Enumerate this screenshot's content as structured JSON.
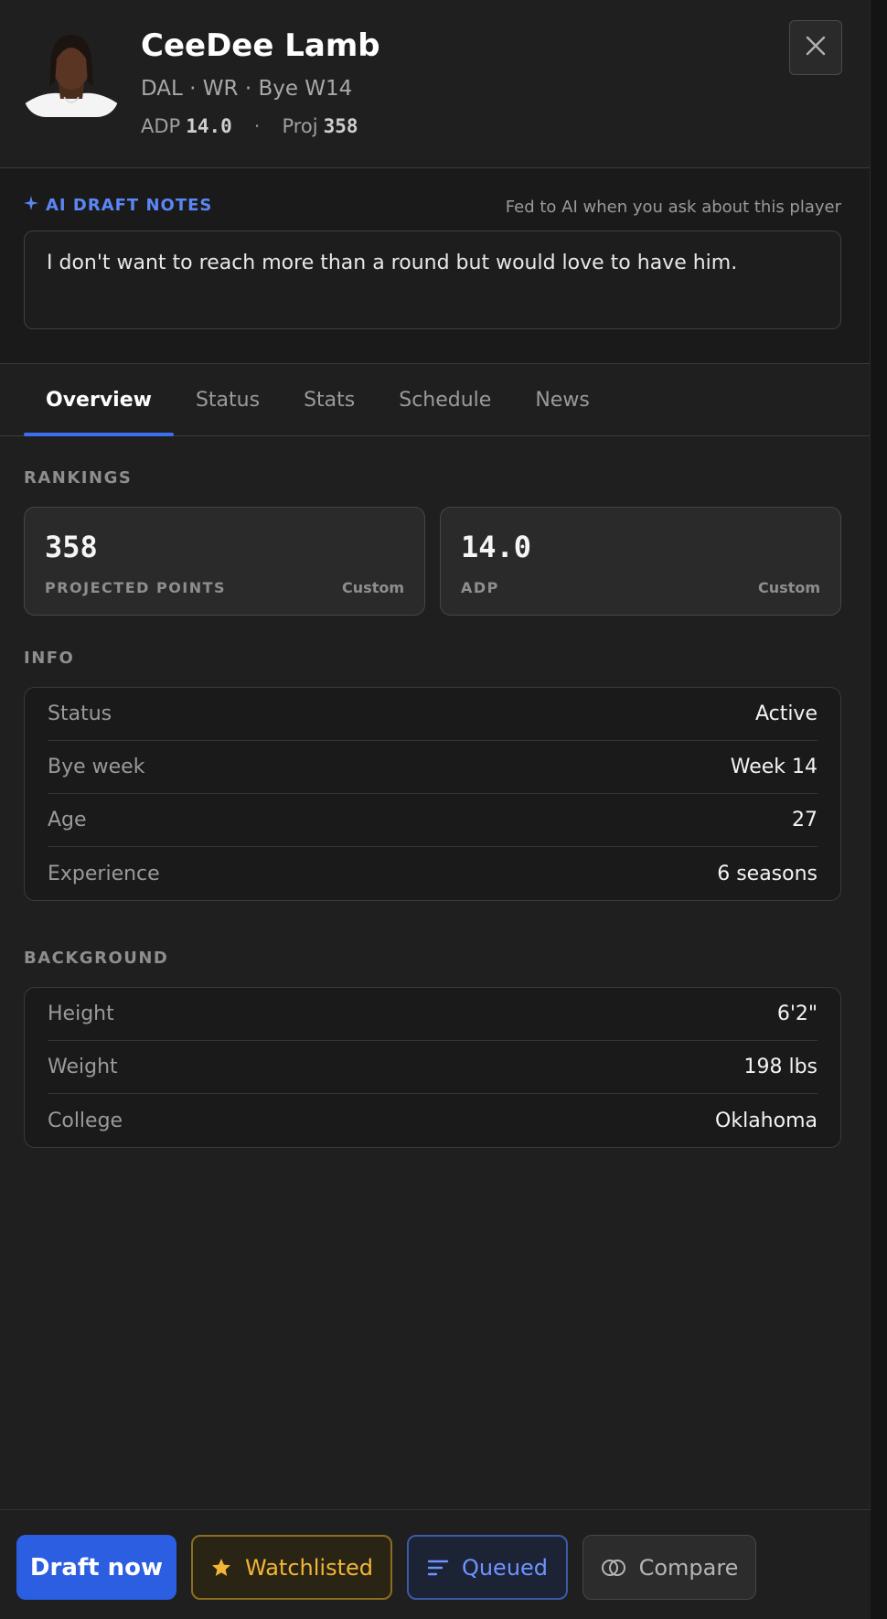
{
  "player": {
    "name": "CeeDee Lamb",
    "meta": "DAL · WR · Bye W14",
    "adp_label": "ADP",
    "adp_value": "14.0",
    "separator": "·",
    "proj_label": "Proj",
    "proj_value": "358"
  },
  "notes": {
    "label": "AI DRAFT NOTES",
    "hint": "Fed to AI when you ask about this player",
    "text": "I don't want to reach more than a round but would love to have him."
  },
  "tabs": [
    {
      "label": "Overview",
      "active": true
    },
    {
      "label": "Status"
    },
    {
      "label": "Stats"
    },
    {
      "label": "Schedule"
    },
    {
      "label": "News"
    }
  ],
  "rankings": {
    "title": "RANKINGS",
    "cards": [
      {
        "value": "358",
        "label": "PROJECTED POINTS",
        "source": "Custom"
      },
      {
        "value": "14.0",
        "label": "ADP",
        "source": "Custom"
      }
    ]
  },
  "info": {
    "title": "INFO",
    "rows": [
      {
        "key": "Status",
        "value": "Active"
      },
      {
        "key": "Bye week",
        "value": "Week 14"
      },
      {
        "key": "Age",
        "value": "27"
      },
      {
        "key": "Experience",
        "value": "6 seasons"
      }
    ]
  },
  "background": {
    "title": "BACKGROUND",
    "rows": [
      {
        "key": "Height",
        "value": "6'2\""
      },
      {
        "key": "Weight",
        "value": "198 lbs"
      },
      {
        "key": "College",
        "value": "Oklahoma"
      }
    ]
  },
  "footer": {
    "draft_label": "Draft now",
    "watch_label": "Watchlisted",
    "queue_label": "Queued",
    "compare_label": "Compare"
  },
  "colors": {
    "accent": "#2b5ee0",
    "ai_label": "#5b86f5",
    "watch": "#f2b636",
    "queue": "#6d94ff"
  }
}
